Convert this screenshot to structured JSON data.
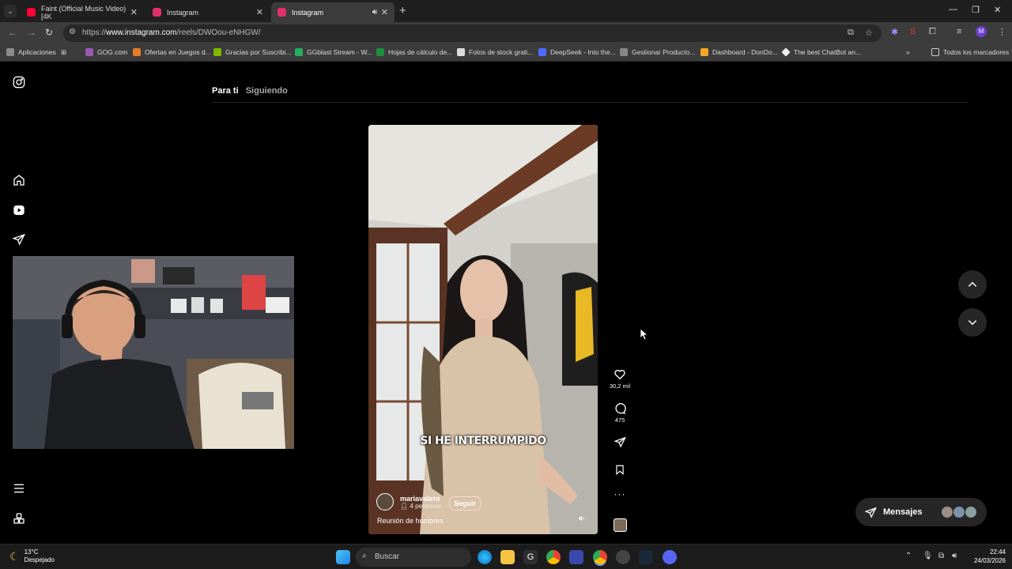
{
  "browser": {
    "tabs": [
      {
        "title": "Faint (Official Music Video) [4K",
        "favicon_color": "#ff0033",
        "active": false
      },
      {
        "title": "Instagram",
        "favicon_color": "#e1306c",
        "active": false
      },
      {
        "title": "Instagram",
        "favicon_color": "#e1306c",
        "active": true
      }
    ],
    "url_host": "www.instagram.com",
    "url_prefix": "https://",
    "url_path": "/reels/DWOou-eNHGW/",
    "bookmarks": [
      {
        "label": "Aplicaciones",
        "icon_color": "#8a8a8a"
      },
      {
        "label": "GOG.com",
        "icon_color": "#9b59b6"
      },
      {
        "label": "Ofertas en Juegos d...",
        "icon_color": "#e67e22"
      },
      {
        "label": "Gracias por Suscribi...",
        "icon_color": "#7fb800"
      },
      {
        "label": "GGblast Stream - W...",
        "icon_color": "#27ae60"
      },
      {
        "label": "Hojas de cálculo de...",
        "icon_color": "#1e8e3e"
      },
      {
        "label": "Fotos de stock grati...",
        "icon_color": "#dddddd"
      },
      {
        "label": "DeepSeek - Into the...",
        "icon_color": "#4d6bfe"
      },
      {
        "label": "Gestionar Producto...",
        "icon_color": "#888888"
      },
      {
        "label": "Dashboard - DonDo...",
        "icon_color": "#f5a623"
      },
      {
        "label": "The best ChatBot an...",
        "icon_color": "#eeeeee"
      }
    ],
    "all_bookmarks_label": "Todos los marcadores"
  },
  "instagram": {
    "feed_tabs": [
      "Para ti",
      "Siguiendo"
    ],
    "reel": {
      "caption_overlay": "SI HE INTERRUMPIDO",
      "username": "mariavalero",
      "people": "4 personas",
      "follow_label": "Seguir",
      "audio": "Reunión de hombres",
      "likes": "30,2 mil",
      "comments": "475"
    },
    "messages_label": "Mensajes"
  },
  "taskbar": {
    "temperature": "13°C",
    "weather": "Despejado",
    "search_label": "Buscar",
    "time": "22:44",
    "date": "24/03/2026"
  },
  "colors": {
    "accent": "#0095f6",
    "background": "#000000",
    "surface": "#262626"
  }
}
